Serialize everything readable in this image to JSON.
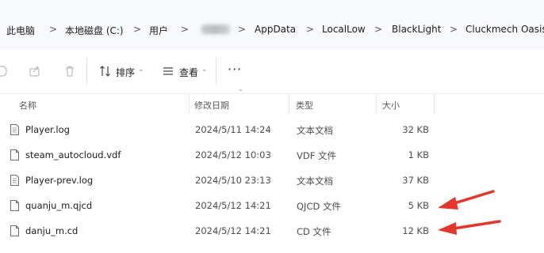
{
  "breadcrumb": {
    "items": [
      "此电脑",
      "本地磁盘 (C:)",
      "用户",
      "",
      "AppData",
      "LocalLow",
      "BlackLight",
      "Cluckmech Oasis"
    ],
    "separator": ">"
  },
  "toolbar": {
    "sort_label": "排序",
    "view_label": "查看",
    "more_label": "···"
  },
  "columns": {
    "name": "名称",
    "modified": "修改日期",
    "type": "类型",
    "size": "大小"
  },
  "files": [
    {
      "name": "Player.log",
      "modified": "2024/5/11 14:24",
      "type": "文本文档",
      "size": "32 KB"
    },
    {
      "name": "steam_autocloud.vdf",
      "modified": "2024/5/12 10:03",
      "type": "VDF 文件",
      "size": "1 KB"
    },
    {
      "name": "Player-prev.log",
      "modified": "2024/5/10 23:13",
      "type": "文本文档",
      "size": "37 KB"
    },
    {
      "name": "quanju_m.qjcd",
      "modified": "2024/5/12 14:21",
      "type": "QJCD 文件",
      "size": "5 KB"
    },
    {
      "name": "danju_m.cd",
      "modified": "2024/5/12 14:21",
      "type": "CD 文件",
      "size": "12 KB"
    }
  ],
  "colors": {
    "arrow": "#e5362c",
    "address_bg": "#f7f9fc"
  }
}
